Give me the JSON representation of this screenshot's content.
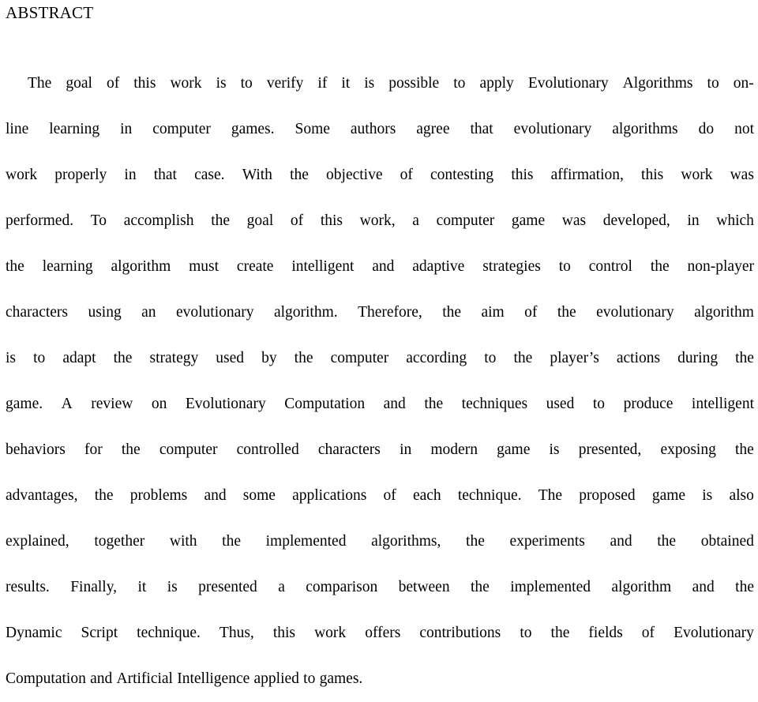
{
  "document": {
    "type": "academic-paper-abstract",
    "background_color": "#ffffff",
    "text_color": "#000000"
  },
  "heading": {
    "label": "ABSTRACT"
  },
  "abstract": {
    "full_text": "The goal of this work is to verify if it is possible to apply Evolutionary Algorithms to on-line learning in computer games. Some authors agree that evolutionary algorithms do not work properly in that case. With the objective of contesting this affirmation, this work was performed. To accomplish the goal of this work, a computer game was developed, in which the learning algorithm must create intelligent and adaptive strategies to control the non-player characters using an evolutionary algorithm. Therefore, the aim of the evolutionary algorithm is to adapt the strategy used by the computer according to the player’s actions during the game. A review on Evolutionary Computation and the techniques used to produce intelligent behaviors for the computer controlled characters in modern game is presented, exposing the advantages, the problems and some applications of each technique. The proposed game is also explained, together with the implemented algorithms, the experiments and the obtained results. Finally, it is presented a comparison between the implemented algorithm and the Dynamic Script technique. Thus, this work offers contributions to the fields of Evolutionary Computation and Artificial Intelligence applied to games.",
    "lines": [
      {
        "text": "The goal of this work is to verify if it is possible to apply Evolutionary Algorithms to on-",
        "indent": true,
        "last": false
      },
      {
        "text": "line learning in computer games. Some authors agree that evolutionary algorithms do not",
        "indent": false,
        "last": false
      },
      {
        "text": "work properly in that case. With the objective of contesting this affirmation, this work was",
        "indent": false,
        "last": false
      },
      {
        "text": "performed. To accomplish the goal of this work, a computer game was developed, in which",
        "indent": false,
        "last": false
      },
      {
        "text": "the learning algorithm must create intelligent and adaptive strategies to control the non-player",
        "indent": false,
        "last": false
      },
      {
        "text": "characters using an evolutionary algorithm. Therefore, the aim of the evolutionary algorithm",
        "indent": false,
        "last": false
      },
      {
        "text": "is to adapt the strategy used by the computer according to the player’s actions during the",
        "indent": false,
        "last": false
      },
      {
        "text": "game. A review on Evolutionary Computation and the techniques used to produce intelligent",
        "indent": false,
        "last": false
      },
      {
        "text": "behaviors for the computer controlled characters in modern game is presented, exposing the",
        "indent": false,
        "last": false
      },
      {
        "text": "advantages, the problems and some applications of each technique. The proposed game is also",
        "indent": false,
        "last": false
      },
      {
        "text": "explained, together with the implemented algorithms, the experiments and the obtained",
        "indent": false,
        "last": false
      },
      {
        "text": "results. Finally, it is presented a comparison between the implemented algorithm and the",
        "indent": false,
        "last": false
      },
      {
        "text": "Dynamic Script technique. Thus, this work offers contributions to the fields of Evolutionary",
        "indent": false,
        "last": false
      },
      {
        "text": "Computation and Artificial Intelligence applied to games.",
        "indent": false,
        "last": true
      }
    ]
  }
}
